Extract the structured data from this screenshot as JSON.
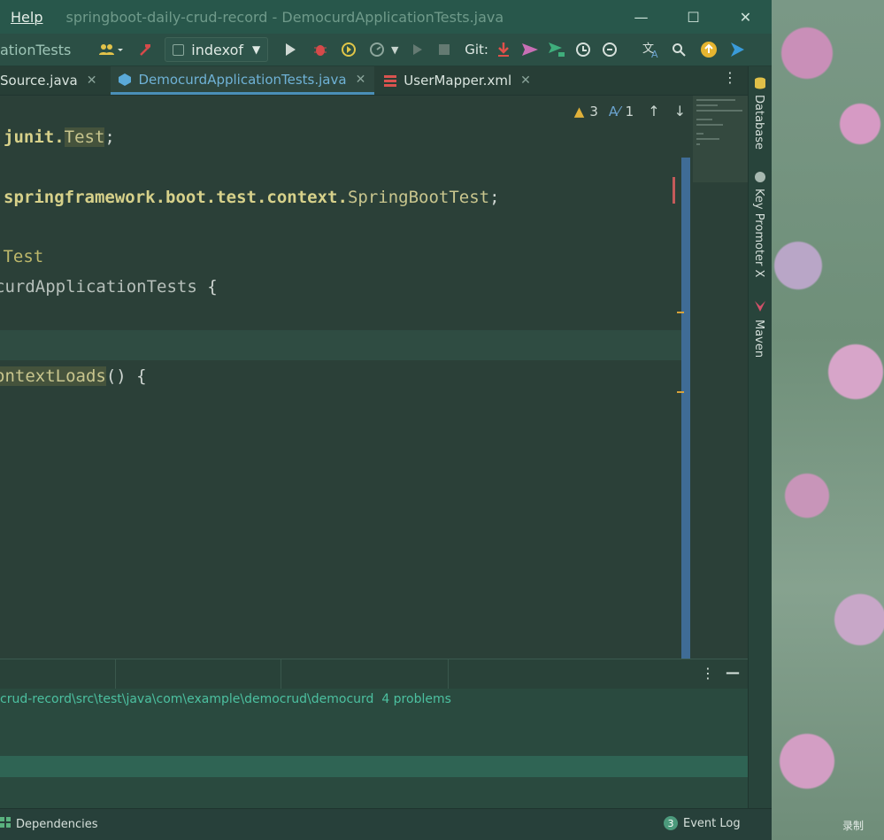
{
  "window": {
    "menu_help": "Help",
    "title": "springboot-daily-crud-record - DemocurdApplicationTests.java",
    "controls": {
      "minimize": "—",
      "maximize": "☐",
      "close": "✕"
    }
  },
  "toolbar": {
    "breadcrumb": "ationTests",
    "run_config": "indexof",
    "git_label": "Git:"
  },
  "tabs": [
    {
      "label": "Source.java",
      "active": false
    },
    {
      "label": "DemocurdApplicationTests.java",
      "active": true
    },
    {
      "label": "UserMapper.xml",
      "active": false
    }
  ],
  "editor": {
    "warnings_count": "3",
    "typos_count": "1",
    "lines": {
      "l1_a": "junit.",
      "l1_b": "Test",
      "l1_c": ";",
      "l2_a": "springframework.boot.test.context.",
      "l2_b": "SpringBootTest",
      "l2_c": ";",
      "l3": ":Test",
      "l4_a": "curdApplicationTests",
      "l4_b": " {",
      "l5_a": "ontextLoads",
      "l5_b": "() {"
    }
  },
  "right_strip": {
    "database": "Database",
    "key_promoter": "Key Promoter X",
    "maven": "Maven"
  },
  "problems": {
    "path": "crud-record\\src\\test\\java\\com\\example\\democrud\\democurd",
    "count": "4 problems"
  },
  "statusbar": {
    "dependencies": "Dependencies",
    "event_log": "Event Log",
    "event_badge": "3"
  },
  "overlay": {
    "record_label": "录制"
  }
}
